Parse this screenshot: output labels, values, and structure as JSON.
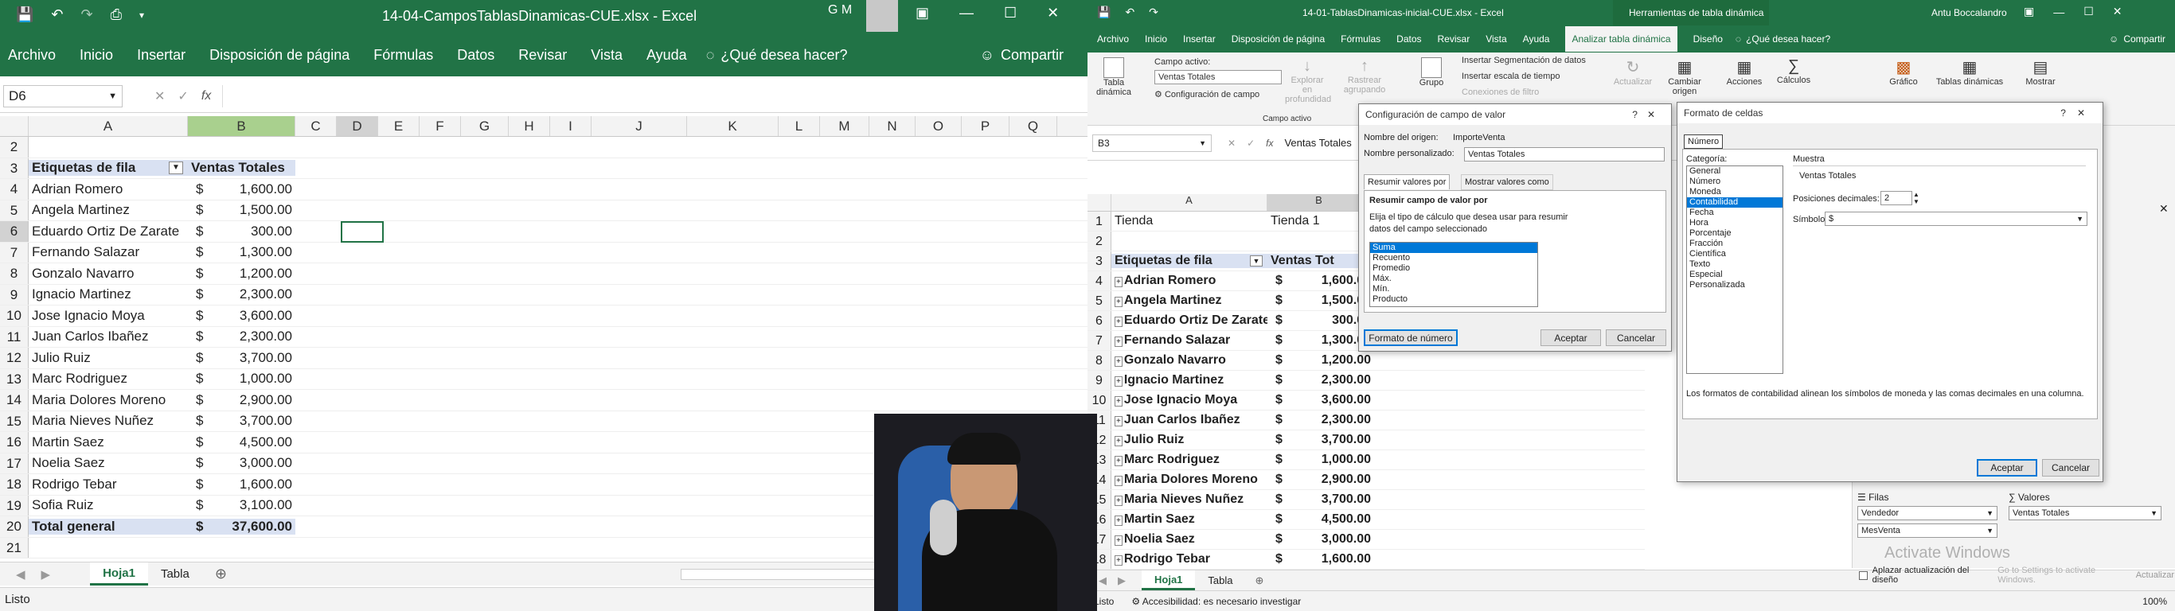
{
  "left": {
    "title": "14-04-CamposTablasDinamicas-CUE.xlsx  -  Excel",
    "user_initials": "G M",
    "ribbon_tabs": [
      "Archivo",
      "Inicio",
      "Insertar",
      "Disposición de página",
      "Fórmulas",
      "Datos",
      "Revisar",
      "Vista",
      "Ayuda"
    ],
    "tell_me": "¿Qué desea hacer?",
    "share": "Compartir",
    "name_box": "D6",
    "formula_fx": "fx",
    "columns": [
      "A",
      "B",
      "C",
      "D",
      "E",
      "F",
      "G",
      "H",
      "I",
      "J",
      "K",
      "L",
      "M",
      "N",
      "O",
      "P",
      "Q"
    ],
    "rows": [
      {
        "n": "2",
        "a": "",
        "c": "",
        "v": ""
      },
      {
        "n": "3",
        "a": "Etiquetas de fila",
        "c": "",
        "v": "Ventas Totales",
        "hdr": true
      },
      {
        "n": "4",
        "a": "Adrian Romero",
        "c": "$",
        "v": "1,600.00"
      },
      {
        "n": "5",
        "a": "Angela Martinez",
        "c": "$",
        "v": "1,500.00"
      },
      {
        "n": "6",
        "a": "Eduardo Ortiz De Zarate",
        "c": "$",
        "v": "300.00"
      },
      {
        "n": "7",
        "a": "Fernando Salazar",
        "c": "$",
        "v": "1,300.00"
      },
      {
        "n": "8",
        "a": "Gonzalo Navarro",
        "c": "$",
        "v": "1,200.00"
      },
      {
        "n": "9",
        "a": "Ignacio Martinez",
        "c": "$",
        "v": "2,300.00"
      },
      {
        "n": "10",
        "a": "Jose Ignacio Moya",
        "c": "$",
        "v": "3,600.00"
      },
      {
        "n": "11",
        "a": "Juan Carlos Ibañez",
        "c": "$",
        "v": "2,300.00"
      },
      {
        "n": "12",
        "a": "Julio Ruiz",
        "c": "$",
        "v": "3,700.00"
      },
      {
        "n": "13",
        "a": "Marc Rodriguez",
        "c": "$",
        "v": "1,000.00"
      },
      {
        "n": "14",
        "a": "Maria Dolores Moreno",
        "c": "$",
        "v": "2,900.00"
      },
      {
        "n": "15",
        "a": "Maria Nieves Nuñez",
        "c": "$",
        "v": "3,700.00"
      },
      {
        "n": "16",
        "a": "Martin Saez",
        "c": "$",
        "v": "4,500.00"
      },
      {
        "n": "17",
        "a": "Noelia Saez",
        "c": "$",
        "v": "3,000.00"
      },
      {
        "n": "18",
        "a": "Rodrigo Tebar",
        "c": "$",
        "v": "1,600.00"
      },
      {
        "n": "19",
        "a": "Sofia Ruiz",
        "c": "$",
        "v": "3,100.00"
      },
      {
        "n": "20",
        "a": "Total general",
        "c": "$",
        "v": "37,600.00",
        "total": true
      },
      {
        "n": "21",
        "a": "",
        "c": "",
        "v": ""
      }
    ],
    "sheets": [
      "Hoja1",
      "Tabla"
    ],
    "status": "Listo"
  },
  "right": {
    "title": "14-01-TablasDinamicas-inicial-CUE.xlsx  -  Excel",
    "tools_title": "Herramientas de tabla dinámica",
    "user": "Antu Boccalandro",
    "ribbon_tabs": [
      "Archivo",
      "Inicio",
      "Insertar",
      "Disposición de página",
      "Fórmulas",
      "Datos",
      "Revisar",
      "Vista",
      "Ayuda",
      "Analizar tabla dinámica",
      "Diseño"
    ],
    "tell_me": "¿Qué desea hacer?",
    "share": "Compartir",
    "ribbon": {
      "tabla_dinamica": "Tabla dinámica",
      "campo_activo_label": "Campo activo:",
      "campo_activo_value": "Ventas Totales",
      "config_campo": "Configuración de campo",
      "explorar": "Explorar en profundidad",
      "rastrear": "Rastrear agrupando",
      "grupo": "Grupo",
      "group_label": "Campo activo",
      "ins_seg": "Insertar Segmentación de datos",
      "ins_escala": "Insertar escala de tiempo",
      "conexiones": "Conexiones de filtro",
      "actualizar": "Actualizar",
      "cambiar_origen": "Cambiar origen",
      "acciones": "Acciones",
      "calculos": "Cálculos",
      "grafico": "Gráfico",
      "tablas_rec": "Tablas dinámicas",
      "mostrar": "Mostrar"
    },
    "name_box": "B3",
    "formula_value": "Ventas Totales",
    "columns": [
      "A",
      "B"
    ],
    "rows": [
      {
        "n": "1",
        "a": "Tienda",
        "c": "",
        "v": "Tienda 1",
        "plain": true
      },
      {
        "n": "2",
        "a": "",
        "c": "",
        "v": ""
      },
      {
        "n": "3",
        "a": "Etiquetas de fila",
        "c": "",
        "v": "Ventas Tot",
        "hdr": true
      },
      {
        "n": "4",
        "a": "Adrian Romero",
        "c": "$",
        "v": "1,600.00"
      },
      {
        "n": "5",
        "a": "Angela Martinez",
        "c": "$",
        "v": "1,500.00"
      },
      {
        "n": "6",
        "a": "Eduardo Ortiz De Zarate",
        "c": "$",
        "v": "300.00"
      },
      {
        "n": "7",
        "a": "Fernando Salazar",
        "c": "$",
        "v": "1,300.00"
      },
      {
        "n": "8",
        "a": "Gonzalo Navarro",
        "c": "$",
        "v": "1,200.00"
      },
      {
        "n": "9",
        "a": "Ignacio Martinez",
        "c": "$",
        "v": "2,300.00"
      },
      {
        "n": "10",
        "a": "Jose Ignacio Moya",
        "c": "$",
        "v": "3,600.00"
      },
      {
        "n": "11",
        "a": "Juan Carlos Ibañez",
        "c": "$",
        "v": "2,300.00"
      },
      {
        "n": "12",
        "a": "Julio Ruiz",
        "c": "$",
        "v": "3,700.00"
      },
      {
        "n": "13",
        "a": "Marc Rodriguez",
        "c": "$",
        "v": "1,000.00"
      },
      {
        "n": "14",
        "a": "Maria Dolores Moreno",
        "c": "$",
        "v": "2,900.00"
      },
      {
        "n": "15",
        "a": "Maria Nieves Nuñez",
        "c": "$",
        "v": "3,700.00"
      },
      {
        "n": "16",
        "a": "Martin Saez",
        "c": "$",
        "v": "4,500.00"
      },
      {
        "n": "17",
        "a": "Noelia Saez",
        "c": "$",
        "v": "3,000.00"
      },
      {
        "n": "18",
        "a": "Rodrigo Tebar",
        "c": "$",
        "v": "1,600.00"
      }
    ],
    "sheets": [
      "Hoja1",
      "Tabla"
    ],
    "status": "Listo",
    "accessibility": "Accesibilidad: es necesario investigar",
    "zoom": "100%",
    "pane": {
      "filas_label": "Filas",
      "valores_label": "Valores",
      "filas_items": [
        "Vendedor",
        "MesVenta"
      ],
      "valores_items": [
        "Ventas Totales"
      ],
      "defer": "Aplazar actualización del diseño",
      "update": "Actualizar"
    },
    "activate": {
      "title": "Activate Windows",
      "sub": "Go to Settings to activate Windows."
    }
  },
  "dialog_campo": {
    "title": "Configuración de campo de valor",
    "source_label": "Nombre del origen:",
    "source_value": "ImporteVenta",
    "custom_label": "Nombre personalizado:",
    "custom_value": "Ventas Totales",
    "tab1": "Resumir valores por",
    "tab2": "Mostrar valores como",
    "section": "Resumir campo de valor por",
    "desc": "Elija el tipo de cálculo que desea usar para resumir datos del campo seleccionado",
    "items": [
      "Suma",
      "Recuento",
      "Promedio",
      "Máx.",
      "Mín.",
      "Producto"
    ],
    "selected": "Suma",
    "formato_btn": "Formato de número",
    "ok": "Aceptar",
    "cancel": "Cancelar"
  },
  "dialog_formato": {
    "title": "Formato de celdas",
    "tab": "Número",
    "category_label": "Categoría:",
    "categories": [
      "General",
      "Número",
      "Moneda",
      "Contabilidad",
      "Fecha",
      "Hora",
      "Porcentaje",
      "Fracción",
      "Científica",
      "Texto",
      "Especial",
      "Personalizada"
    ],
    "selected": "Contabilidad",
    "sample_label": "Muestra",
    "sample_value": "Ventas Totales",
    "decimals_label": "Posiciones decimales:",
    "decimals_value": "2",
    "symbol_label": "Símbolo:",
    "symbol_value": "$",
    "desc": "Los formatos de contabilidad alinean los símbolos de moneda y las comas decimales en una columna.",
    "ok": "Aceptar",
    "cancel": "Cancelar"
  },
  "colors": {
    "excel_green": "#217346",
    "selection_blue": "#0078d7",
    "pivot_header_fill": "#d9e1f2"
  }
}
